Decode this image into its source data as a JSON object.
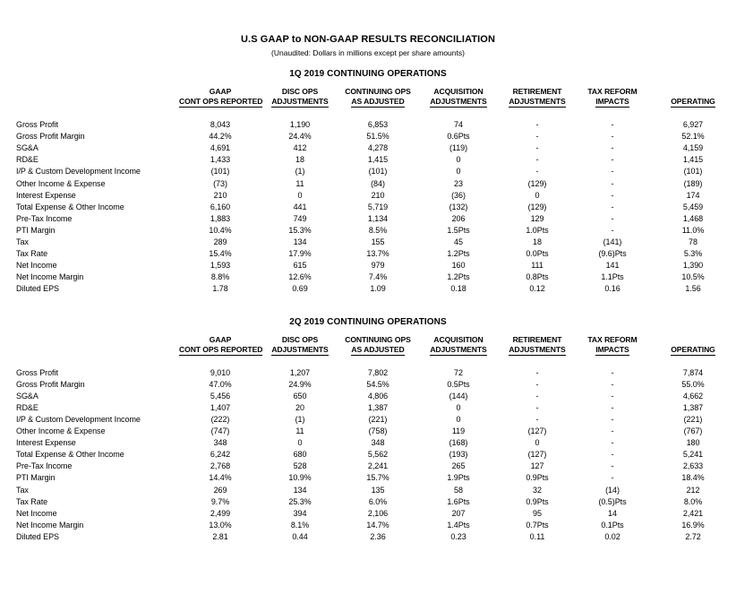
{
  "document": {
    "title": "U.S GAAP to NON-GAAP RESULTS RECONCILIATION",
    "subtitle": "(Unaudited: Dollars in millions except per share amounts)"
  },
  "columns": [
    {
      "line1": "",
      "line2": ""
    },
    {
      "line1": "GAAP",
      "line2": "CONT OPS REPORTED"
    },
    {
      "line1": "DISC OPS",
      "line2": "ADJUSTMENTS"
    },
    {
      "line1": "CONTINUING OPS",
      "line2": "AS ADJUSTED"
    },
    {
      "line1": "ACQUISITION",
      "line2": "ADJUSTMENTS"
    },
    {
      "line1": "RETIREMENT",
      "line2": "ADJUSTMENTS"
    },
    {
      "line1": "TAX REFORM",
      "line2": "IMPACTS"
    },
    {
      "line1": "",
      "line2": "OPERATING"
    }
  ],
  "row_labels": [
    "Gross Profit",
    "Gross Profit Margin",
    "SG&A",
    "RD&E",
    "I/P & Custom Development Income",
    "Other Income & Expense",
    "Interest Expense",
    "Total Expense & Other Income",
    "Pre-Tax Income",
    "PTI Margin",
    "Tax",
    "Tax Rate",
    "Net Income",
    "Net Income Margin",
    "Diluted EPS"
  ],
  "sections": [
    {
      "title": "1Q 2019 CONTINUING OPERATIONS",
      "rows": [
        {
          "label": "Gross Profit",
          "values": [
            "8,043",
            "1,190",
            "6,853",
            "74",
            "-",
            "-",
            "6,927"
          ]
        },
        {
          "label": "Gross Profit Margin",
          "values": [
            "44.2%",
            "24.4%",
            "51.5%",
            "0.6Pts",
            "-",
            "-",
            "52.1%"
          ]
        },
        {
          "label": "SG&A",
          "values": [
            "4,691",
            "412",
            "4,278",
            "(119)",
            "-",
            "-",
            "4,159"
          ]
        },
        {
          "label": "RD&E",
          "values": [
            "1,433",
            "18",
            "1,415",
            "0",
            "-",
            "-",
            "1,415"
          ]
        },
        {
          "label": "I/P & Custom Development Income",
          "values": [
            "(101)",
            "(1)",
            "(101)",
            "0",
            "-",
            "-",
            "(101)"
          ]
        },
        {
          "label": "Other Income & Expense",
          "values": [
            "(73)",
            "11",
            "(84)",
            "23",
            "(129)",
            "-",
            "(189)"
          ]
        },
        {
          "label": "Interest Expense",
          "values": [
            "210",
            "0",
            "210",
            "(36)",
            "0",
            "-",
            "174"
          ]
        },
        {
          "label": "Total Expense & Other Income",
          "values": [
            "6,160",
            "441",
            "5,719",
            "(132)",
            "(129)",
            "-",
            "5,459"
          ]
        },
        {
          "label": "Pre-Tax Income",
          "values": [
            "1,883",
            "749",
            "1,134",
            "206",
            "129",
            "-",
            "1,468"
          ]
        },
        {
          "label": "PTI Margin",
          "values": [
            "10.4%",
            "15.3%",
            "8.5%",
            "1.5Pts",
            "1.0Pts",
            "-",
            "11.0%"
          ]
        },
        {
          "label": "Tax",
          "values": [
            "289",
            "134",
            "155",
            "45",
            "18",
            "(141)",
            "78"
          ]
        },
        {
          "label": "Tax Rate",
          "values": [
            "15.4%",
            "17.9%",
            "13.7%",
            "1.2Pts",
            "0.0Pts",
            "(9.6)Pts",
            "5.3%"
          ]
        },
        {
          "label": "Net Income",
          "values": [
            "1,593",
            "615",
            "979",
            "160",
            "111",
            "141",
            "1,390"
          ]
        },
        {
          "label": "Net Income Margin",
          "values": [
            "8.8%",
            "12.6%",
            "7.4%",
            "1.2Pts",
            "0.8Pts",
            "1.1Pts",
            "10.5%"
          ]
        },
        {
          "label": "Diluted EPS",
          "values": [
            "1.78",
            "0.69",
            "1.09",
            "0.18",
            "0.12",
            "0.16",
            "1.56"
          ]
        }
      ]
    },
    {
      "title": "2Q 2019 CONTINUING OPERATIONS",
      "rows": [
        {
          "label": "Gross Profit",
          "values": [
            "9,010",
            "1,207",
            "7,802",
            "72",
            "-",
            "-",
            "7,874"
          ]
        },
        {
          "label": "Gross Profit Margin",
          "values": [
            "47.0%",
            "24.9%",
            "54.5%",
            "0.5Pts",
            "-",
            "-",
            "55.0%"
          ]
        },
        {
          "label": "SG&A",
          "values": [
            "5,456",
            "650",
            "4,806",
            "(144)",
            "-",
            "-",
            "4,662"
          ]
        },
        {
          "label": "RD&E",
          "values": [
            "1,407",
            "20",
            "1,387",
            "0",
            "-",
            "-",
            "1,387"
          ]
        },
        {
          "label": "I/P & Custom Development Income",
          "values": [
            "(222)",
            "(1)",
            "(221)",
            "0",
            "-",
            "-",
            "(221)"
          ]
        },
        {
          "label": "Other Income & Expense",
          "values": [
            "(747)",
            "11",
            "(758)",
            "119",
            "(127)",
            "-",
            "(767)"
          ]
        },
        {
          "label": "Interest Expense",
          "values": [
            "348",
            "0",
            "348",
            "(168)",
            "0",
            "-",
            "180"
          ]
        },
        {
          "label": "Total Expense & Other Income",
          "values": [
            "6,242",
            "680",
            "5,562",
            "(193)",
            "(127)",
            "-",
            "5,241"
          ]
        },
        {
          "label": "Pre-Tax Income",
          "values": [
            "2,768",
            "528",
            "2,241",
            "265",
            "127",
            "-",
            "2,633"
          ]
        },
        {
          "label": "PTI Margin",
          "values": [
            "14.4%",
            "10.9%",
            "15.7%",
            "1.9Pts",
            "0.9Pts",
            "-",
            "18.4%"
          ]
        },
        {
          "label": "Tax",
          "values": [
            "269",
            "134",
            "135",
            "58",
            "32",
            "(14)",
            "212"
          ]
        },
        {
          "label": "Tax Rate",
          "values": [
            "9.7%",
            "25.3%",
            "6.0%",
            "1.6Pts",
            "0.9Pts",
            "(0.5)Pts",
            "8.0%"
          ]
        },
        {
          "label": "Net Income",
          "values": [
            "2,499",
            "394",
            "2,106",
            "207",
            "95",
            "14",
            "2,421"
          ]
        },
        {
          "label": "Net Income Margin",
          "values": [
            "13.0%",
            "8.1%",
            "14.7%",
            "1.4Pts",
            "0.7Pts",
            "0.1Pts",
            "16.9%"
          ]
        },
        {
          "label": "Diluted EPS",
          "values": [
            "2.81",
            "0.44",
            "2.36",
            "0.23",
            "0.11",
            "0.02",
            "2.72"
          ]
        }
      ]
    }
  ]
}
